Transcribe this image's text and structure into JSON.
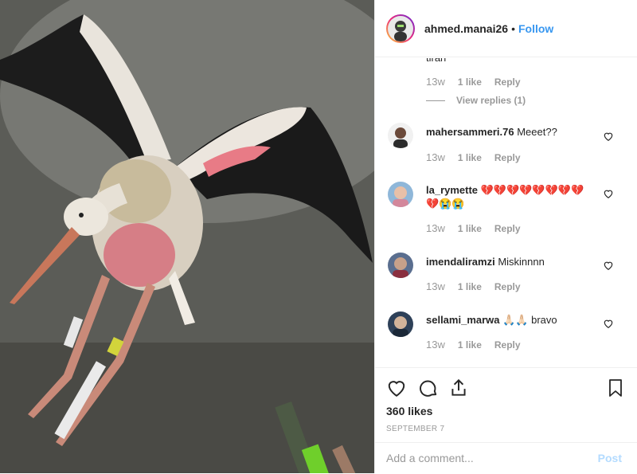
{
  "header": {
    "username": "ahmed.manai26",
    "separator": "•",
    "follow_label": "Follow"
  },
  "comments": {
    "truncated_text": "tiran",
    "first_meta": {
      "age": "13w",
      "likes": "1 like",
      "reply": "Reply"
    },
    "view_replies": "View replies (1)",
    "items": [
      {
        "username": "mahersammeri.76",
        "text": "Meeet??",
        "age": "13w",
        "likes": "1 like",
        "reply": "Reply"
      },
      {
        "username": "la_rymette",
        "text": "💔💔💔💔💔💔💔💔💔😭😭",
        "age": "13w",
        "likes": "1 like",
        "reply": "Reply"
      },
      {
        "username": "imendaliramzi",
        "text": "Miskinnnn",
        "age": "13w",
        "likes": "1 like",
        "reply": "Reply"
      },
      {
        "username": "sellami_marwa",
        "text": "🙏🏻🙏🏻 bravo",
        "age": "13w",
        "likes": "1 like",
        "reply": "Reply"
      }
    ]
  },
  "post": {
    "likes": "360 likes",
    "date": "SEPTEMBER 7"
  },
  "add_comment": {
    "placeholder": "Add a comment...",
    "post_label": "Post"
  },
  "colors": {
    "accent": "#3897f0",
    "muted": "#999999",
    "text": "#262626"
  }
}
